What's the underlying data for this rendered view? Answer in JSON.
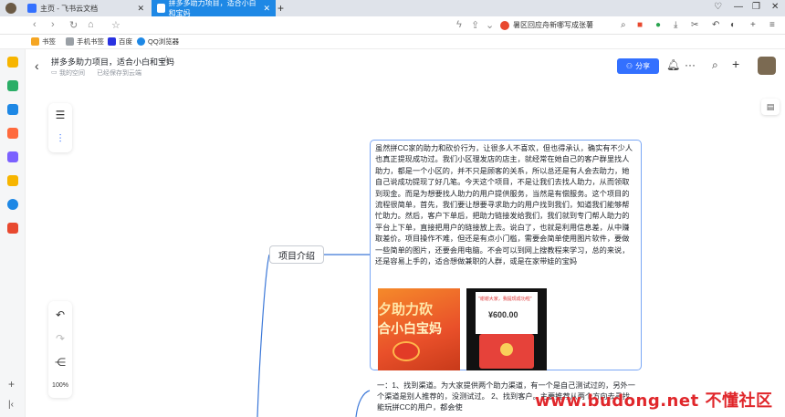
{
  "browser": {
    "tabs": [
      {
        "label": "主页 - 飞书云文档",
        "active": false
      },
      {
        "label": "拼多多助力项目，适合小白和宝妈",
        "active": true
      }
    ],
    "search_text": "暑区回应舟新哪写成张薯",
    "bookmarks": [
      "书签",
      "手机书签",
      "百度",
      "QQ浏览器"
    ]
  },
  "doc": {
    "title": "拼多多助力项目，适合小白和宝妈",
    "location": "我的空间",
    "save_status": "已经保存到云端",
    "share_label": "分享",
    "zoom": "100%"
  },
  "mindmap": {
    "node_label": "项目介绍",
    "card_text": "虽然拼CC家的助力和砍价行为，让很多人不喜欢，但也得承认，确实有不少人也真正提现成功过。我们小区理发店的店主，就经常在她自己的客户群里找人助力，都是一个小区的，并不只是顾客的关系，所以总还是有人会去助力，她自己说成功提现了好几笔。今天这个项目，不是让我们去找人助力，从而领取到现金。而是为想要找人助力的用户提供服务，当然是有偿服务。这个项目的流程很简单，首先，我们要让想要寻求助力的用户找到我们，知道我们能够帮忙助力。然后，客户下单后，把助力链接发给我们，我们就到专门帮人助力的平台上下单，直接把用户的链接放上去。说白了，也就是利用信息差，从中赚取差价。项目操作不难，但还是有点小门槛，需要会简单使用图片软件，要做一些简单的图片，还要会用电脑。不会可以到网上搜教程来学习，总的来说，还是容易上手的，适合想做兼职的人群，或是在家带娃的宝妈",
    "image1": {
      "line1": "夕助力砍",
      "line2": "合小白宝妈"
    },
    "image2": {
      "caption": "\"谢谢大家，我提现成功啦\"",
      "amount": "¥600.00"
    },
    "text_below": "一：1、找到渠道。为大家提供两个助力渠道，有一个是自己测试过的，另外一个渠道是别人推荐的，没测试过。 2、找到客户。主要推荐从两个方向去寻找，能玩拼CC的用户，都会使",
    "watermark": "www.budong.net 不懂社区"
  },
  "colors": {
    "accent": "#3370ff",
    "active_tab": "#1e88e5",
    "card_border": "#7aa7f5",
    "watermark": "#e0272b"
  }
}
